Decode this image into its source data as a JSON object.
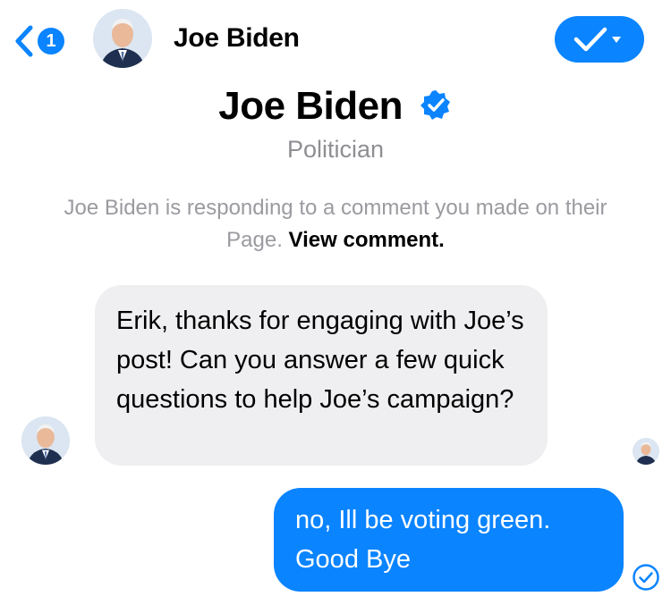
{
  "header": {
    "back_count": "1",
    "name": "Joe Biden"
  },
  "profile": {
    "name": "Joe Biden",
    "role": "Politician"
  },
  "context": {
    "text": "Joe Biden is responding to a comment you made on their Page.",
    "link": "View comment."
  },
  "messages": {
    "incoming": "Erik, thanks for engaging with Joe’s post! Can you answer a few quick questions to help Joe’s campaign?",
    "outgoing": "no, Ill be voting green. Good Bye"
  },
  "icons": {
    "back": "chevron-left-icon",
    "action": "checkmark-dropdown-icon",
    "verified": "verified-badge-icon",
    "delivered": "check-circle-icon"
  },
  "colors": {
    "accent": "#0a84ff",
    "incoming_bubble": "#efeff1",
    "muted_text": "#8e8e93"
  }
}
